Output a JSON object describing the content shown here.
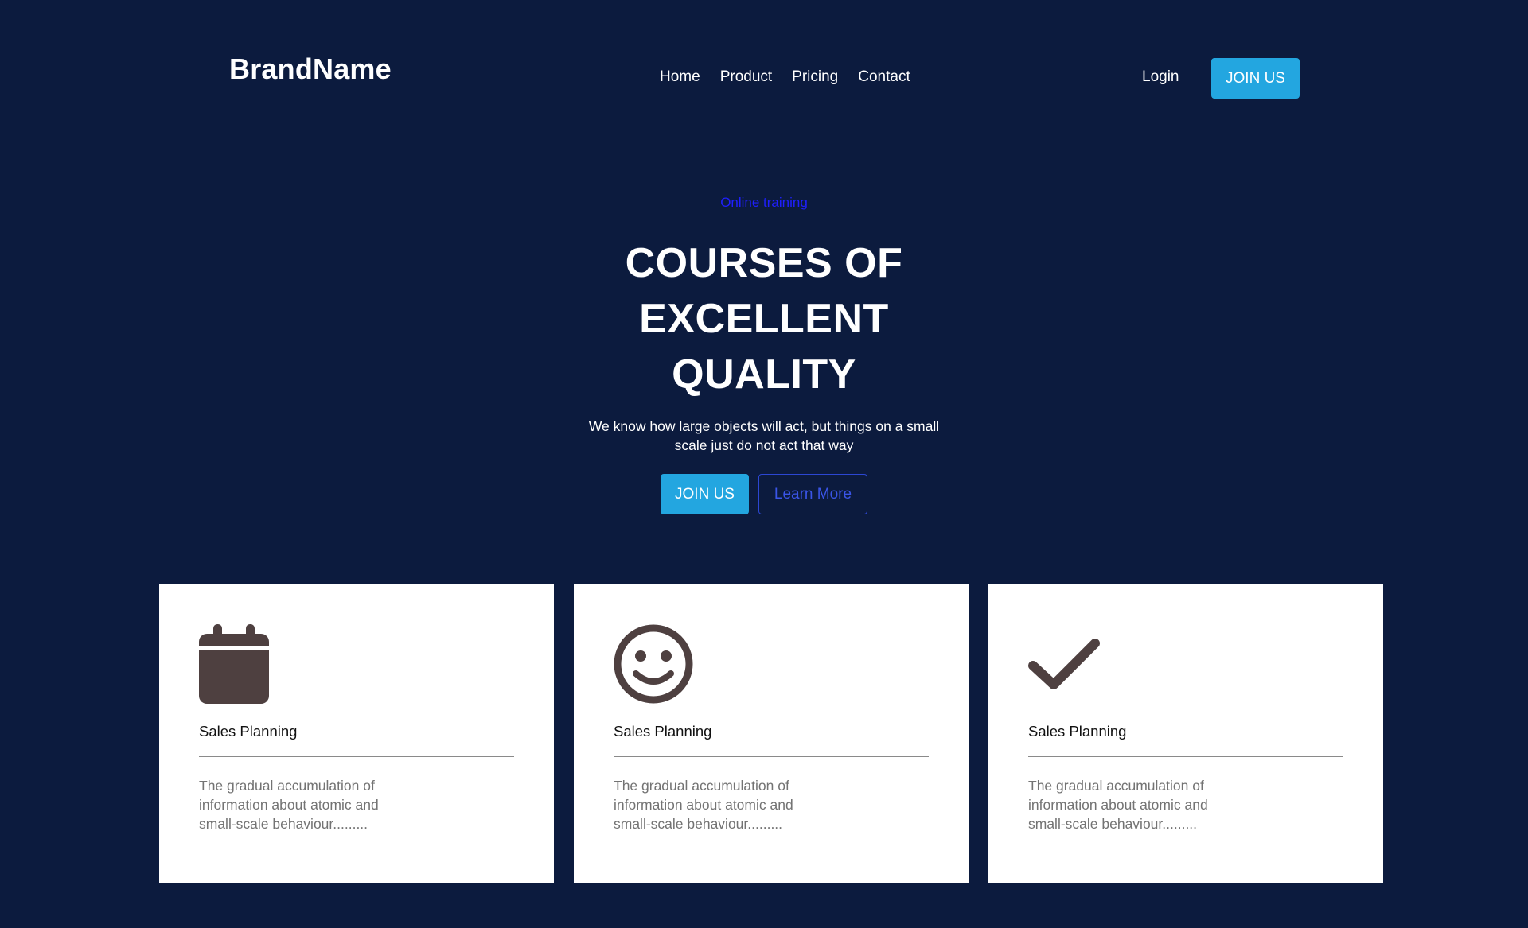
{
  "header": {
    "brand": "BrandName",
    "nav": [
      "Home",
      "Product",
      "Pricing",
      "Contact"
    ],
    "login": "Login",
    "join_label": "JOIN US"
  },
  "hero": {
    "eyebrow": "Online training",
    "title": "COURSES OF EXCELLENT QUALITY",
    "subtitle": "We know how large objects will act, but things on a small scale just do not act that way",
    "join_label": "JOIN US",
    "learn_label": "Learn More"
  },
  "cards": [
    {
      "icon": "calendar-icon",
      "title": "Sales Planning",
      "text": "The gradual accumulation of information about atomic and small-scale behaviour........."
    },
    {
      "icon": "smiley-icon",
      "title": "Sales Planning",
      "text": "The gradual accumulation of information about atomic and small-scale behaviour........."
    },
    {
      "icon": "checkmark-icon",
      "title": "Sales Planning",
      "text": "The gradual accumulation of information about atomic and small-scale behaviour........."
    }
  ],
  "colors": {
    "background": "#0c1b3e",
    "accent": "#23a6e0",
    "eyebrow": "#1f1fff",
    "outline_button": "#2c47d3",
    "icon": "#4e4040"
  }
}
